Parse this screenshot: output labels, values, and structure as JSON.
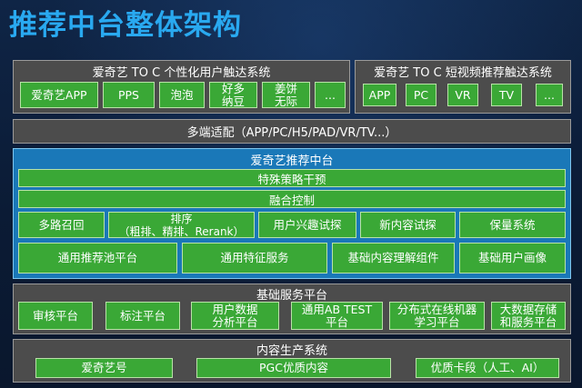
{
  "title": "推荐中台整体架构",
  "toc_personal": {
    "title": "爱奇艺 TO C 个性化用户触达系统",
    "items": [
      "爱奇艺APP",
      "PPS",
      "泡泡",
      "好多\n纳豆",
      "姜饼\n无际",
      "..."
    ]
  },
  "toc_video": {
    "title": "爱奇艺 TO C 短视频推荐触达系统",
    "items": [
      "APP",
      "PC",
      "VR",
      "TV",
      "..."
    ]
  },
  "adapter": "多端适配（APP/PC/H5/PAD/VR/TV...）",
  "hub": {
    "title": "爱奇艺推荐中台",
    "bar1": "特殊策略干预",
    "bar2": "融合控制",
    "row1": [
      "多路召回",
      "排序\n（粗排、精排、Rerank）",
      "用户兴趣试探",
      "新内容试探",
      "保量系统"
    ],
    "row2": [
      "通用推荐池平台",
      "通用特征服务",
      "基础内容理解组件",
      "基础用户画像"
    ]
  },
  "base": {
    "title": "基础服务平台",
    "items": [
      "审核平台",
      "标注平台",
      "用户数据\n分析平台",
      "通用AB TEST\n平台",
      "分布式在线机器\n学习平台",
      "大数据存储\n和服务平台"
    ]
  },
  "content": {
    "title": "内容生产系统",
    "items": [
      "爱奇艺号",
      "PGC优质内容",
      "优质卡段（人工、AI）"
    ]
  },
  "colors": {
    "title_blue": "#29a9f0",
    "green": "#3aa836",
    "panel_gray": "#4c4c4c",
    "hub_blue": "#1a78b8"
  }
}
